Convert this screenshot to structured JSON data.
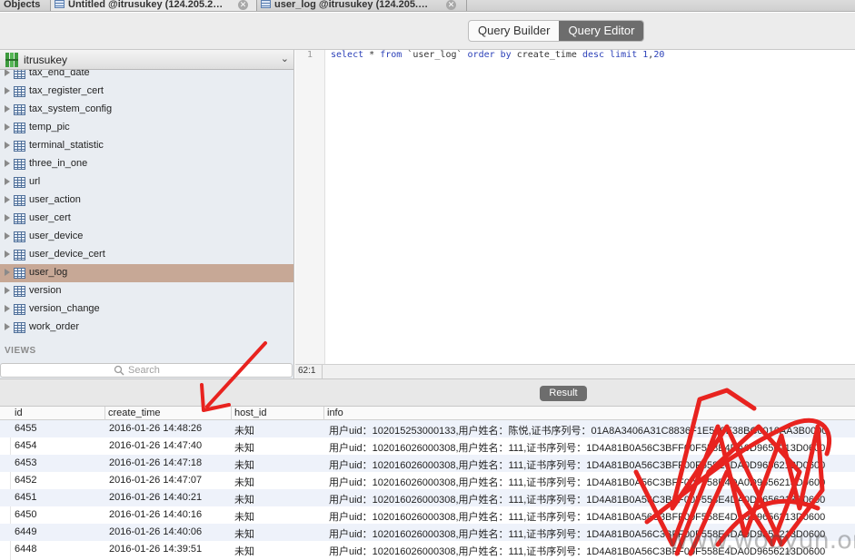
{
  "tabs": [
    {
      "label": "Objects"
    },
    {
      "label": "Untitled @itrusukey (124.205.2…"
    },
    {
      "label": "user_log @itrusukey (124.205.…"
    }
  ],
  "toolbar": {
    "query_builder": "Query Builder",
    "query_editor": "Query Editor"
  },
  "sidebar": {
    "database": "itrusukey",
    "tables": [
      {
        "name": "tax_end_date"
      },
      {
        "name": "tax_register_cert"
      },
      {
        "name": "tax_system_config"
      },
      {
        "name": "temp_pic"
      },
      {
        "name": "terminal_statistic"
      },
      {
        "name": "three_in_one"
      },
      {
        "name": "url"
      },
      {
        "name": "user_action"
      },
      {
        "name": "user_cert"
      },
      {
        "name": "user_device"
      },
      {
        "name": "user_device_cert"
      },
      {
        "name": "user_log"
      },
      {
        "name": "version"
      },
      {
        "name": "version_change"
      },
      {
        "name": "work_order"
      }
    ],
    "selected": "user_log",
    "views_label": "VIEWS",
    "search_placeholder": "Search"
  },
  "editor": {
    "line_number": "1",
    "sql": {
      "kw1": "select",
      "t1": " * ",
      "kw2": "from",
      "t2": " `user_log` ",
      "kw3": "order by",
      "t3": " create_time ",
      "kw4": "desc",
      "t4": " ",
      "kw5": "limit",
      "t5": " ",
      "n1": "1",
      "t6": ",",
      "n2": "20"
    },
    "cursor_position": "62:1"
  },
  "result": {
    "button": "Result",
    "columns": [
      "id",
      "create_time",
      "host_id",
      "info"
    ],
    "rows": [
      {
        "id": "6455",
        "create_time": "2016-01-26 14:48:26",
        "host_id": "未知",
        "info": "用户uid：102015253000133,用户姓名：陈悦,证书序列号：01A8A3406A31C8836F1E589E38BC0016AA3B0000"
      },
      {
        "id": "6454",
        "create_time": "2016-01-26 14:47:40",
        "host_id": "未知",
        "info": "用户uid：102016026000308,用户姓名：111,证书序列号：1D4A81B0A56C3BFF00F558E4DA0D9656213D0600"
      },
      {
        "id": "6453",
        "create_time": "2016-01-26 14:47:18",
        "host_id": "未知",
        "info": "用户uid：102016026000308,用户姓名：111,证书序列号：1D4A81B0A56C3BFF00F558E4DA0D9656213D0600"
      },
      {
        "id": "6452",
        "create_time": "2016-01-26 14:47:07",
        "host_id": "未知",
        "info": "用户uid：102016026000308,用户姓名：111,证书序列号：1D4A81B0A56C3BFF00F558E4DA0D9656213D0600"
      },
      {
        "id": "6451",
        "create_time": "2016-01-26 14:40:21",
        "host_id": "未知",
        "info": "用户uid：102016026000308,用户姓名：111,证书序列号：1D4A81B0A56C3BFF00F558E4DA0D9656213D0600"
      },
      {
        "id": "6450",
        "create_time": "2016-01-26 14:40:16",
        "host_id": "未知",
        "info": "用户uid：102016026000308,用户姓名：111,证书序列号：1D4A81B0A56C3BFF00F558E4DA0D9656213D0600"
      },
      {
        "id": "6449",
        "create_time": "2016-01-26 14:40:06",
        "host_id": "未知",
        "info": "用户uid：102016026000308,用户姓名：111,证书序列号：1D4A81B0A56C3BFF00F558E4DA0D9656213D0600"
      },
      {
        "id": "6448",
        "create_time": "2016-01-26 14:39:51",
        "host_id": "未知",
        "info": "用户uid：102016026000308,用户姓名：111,证书序列号：1D4A81B0A56C3BFF00F558E4DA0D9656213D0600"
      }
    ]
  },
  "watermark": "www.wooyun.org",
  "colors": {
    "annotation_red": "#e8231f",
    "selected_row": "#c7a896",
    "segment_active": "#6d6d6d"
  }
}
